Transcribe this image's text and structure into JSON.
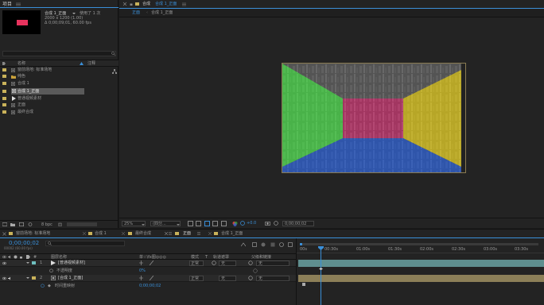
{
  "project": {
    "title": "项目",
    "comp_name": "合成 1_正面",
    "comp_users": "使用了 1 次",
    "comp_size": "2000 x 1200 (1.00)",
    "comp_duration": "Δ 0;00;09;01, 60.00 fps",
    "search_placeholder": "",
    "col_name": "名称",
    "col_comment": "注释",
    "items": [
      {
        "label": "窗前场地: 标准场地",
        "color": "#c9b25a",
        "icon": "composition-icon"
      },
      {
        "label": "纯色",
        "color": "#c9b25a",
        "icon": "folder-icon"
      },
      {
        "label": "合成 1",
        "color": "#c9b25a",
        "icon": "composition-icon"
      },
      {
        "label": "合成 1_正面",
        "color": "#c9b25a",
        "icon": "composition-icon",
        "selected": true
      },
      {
        "label": "普通视频素材",
        "color": "#c9b25a",
        "icon": "footage-icon"
      },
      {
        "label": "正面",
        "color": "#c9b25a",
        "icon": "composition-icon"
      },
      {
        "label": "最终合成",
        "color": "#c9b25a",
        "icon": "composition-icon"
      }
    ],
    "bpc": "8 bpc"
  },
  "viewer": {
    "tab_label": "合成",
    "tab_comp": "合成 1_正面",
    "breadcrumb_active": "正面",
    "breadcrumb_next": "合成 1_正面",
    "zoom": "25%",
    "resolution": "(四分...",
    "exposure": "+0.0",
    "timecode": "0;00;00;02"
  },
  "timeline": {
    "tabs": [
      "窗前场地: 标准场地",
      "合成 1",
      "最终合成",
      "正面",
      "合成 1_正面"
    ],
    "active_tab_index": 3,
    "timecode": "0;00;00;02",
    "frame_info": "00002 (60.00 fps)",
    "col_layer_name": "图层名称",
    "col_switches": "单☆\\fx图◎◎◎",
    "col_mode": "模式",
    "col_trkmat": "T",
    "col_track": "轨道遮罩",
    "col_parent": "父级和链接",
    "layers": [
      {
        "num": "1",
        "name": "[普通视频素材]",
        "color": "#6fbfbf",
        "mode": "正常",
        "track": "无",
        "parent": "无"
      },
      {
        "num": "2",
        "name": "[合成 1_正面]",
        "color": "#c9b25a",
        "mode": "正常",
        "track": "无",
        "parent": "无"
      }
    ],
    "sub1_label": "不透明度",
    "sub1_value": "0%",
    "sub2_label": "时间重映射",
    "sub2_value": "0;00;00;02",
    "ruler": [
      "00s",
      "00:30s",
      "01:00s",
      "01:30s",
      "02:00s",
      "02:30s",
      "03:00s",
      "03:30s"
    ]
  },
  "colors": {
    "green": "#4fe04f",
    "magenta": "#e8337c",
    "blue": "#2b5fd6",
    "yellow": "#e8d020"
  }
}
